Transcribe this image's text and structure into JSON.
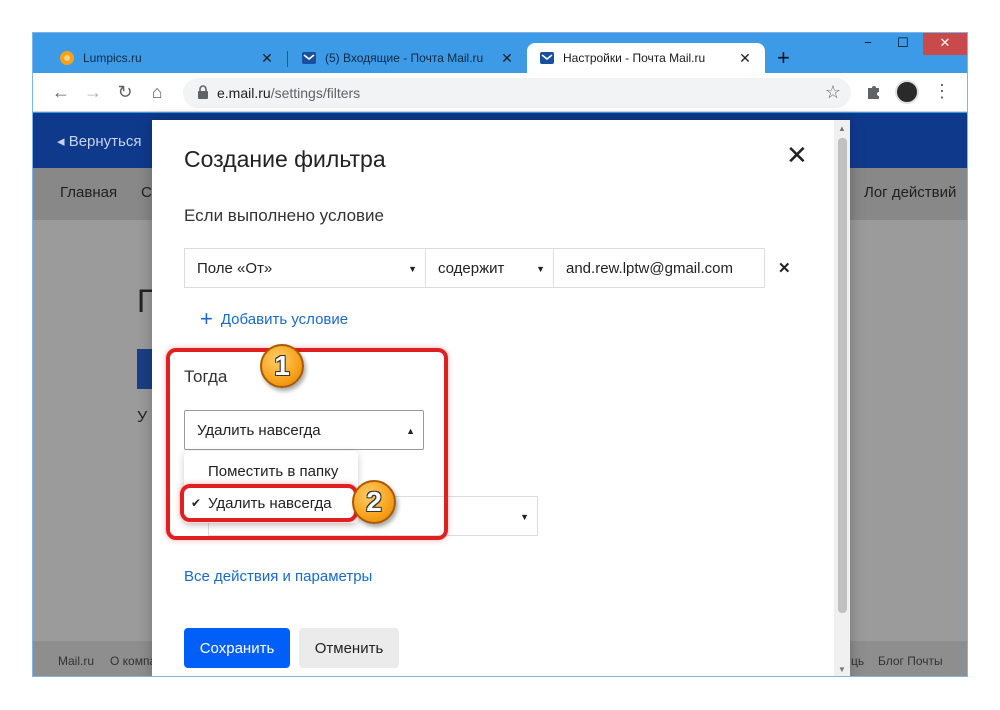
{
  "browser": {
    "tabs": [
      {
        "title": "Lumpics.ru",
        "favicon": "orange-circle",
        "active": false
      },
      {
        "title": "(5) Входящие - Почта Mail.ru",
        "favicon": "mail-envelope",
        "active": false
      },
      {
        "title": "Настройки - Почта Mail.ru",
        "favicon": "mail-envelope",
        "active": true
      }
    ],
    "tab_close": "✕",
    "new_tab": "+",
    "window_controls": {
      "minimize": "−",
      "maximize": "☐",
      "close": "✕"
    },
    "url_host": "e.mail.ru",
    "url_path": "/settings/filters",
    "nav_icons": {
      "back": "←",
      "forward": "→",
      "reload": "↻",
      "home": "⌂",
      "star": "☆",
      "menu": "⋮"
    }
  },
  "background_page": {
    "back_link": "◂  Вернуться",
    "subnav": {
      "left": "Главная",
      "left2": "С",
      "right": "Лог действий"
    },
    "ghost_title": "П",
    "ghost_text": "У",
    "footer": {
      "left": "Mail.ru",
      "left2": "О компа",
      "right1": "ць",
      "right2": "Блог Почты"
    }
  },
  "modal": {
    "title": "Создание фильтра",
    "close": "✕",
    "condition_label": "Если выполнено условие",
    "condition": {
      "field": "Поле «От»",
      "operator": "содержит",
      "value": "and.rew.lptw@gmail.com",
      "remove": "✕"
    },
    "add_condition": "Добавить условие",
    "then_label": "Тогда",
    "action_selected": "Удалить навсегда",
    "dropdown_options": [
      {
        "label": "Поместить в папку",
        "checked": false
      },
      {
        "label": "Удалить навсегда",
        "checked": true
      }
    ],
    "check_mark": "✔",
    "all_actions": "Все действия и параметры",
    "save": "Сохранить",
    "cancel": "Отменить"
  },
  "annotations": {
    "badge1": "1",
    "badge2": "2",
    "highlight_color": "#e02020",
    "badge_color": "#f7a11c"
  },
  "colors": {
    "mail_blue": "#005ff9",
    "link_blue": "#1a69c6",
    "browser_frame": "#3a97e3"
  }
}
